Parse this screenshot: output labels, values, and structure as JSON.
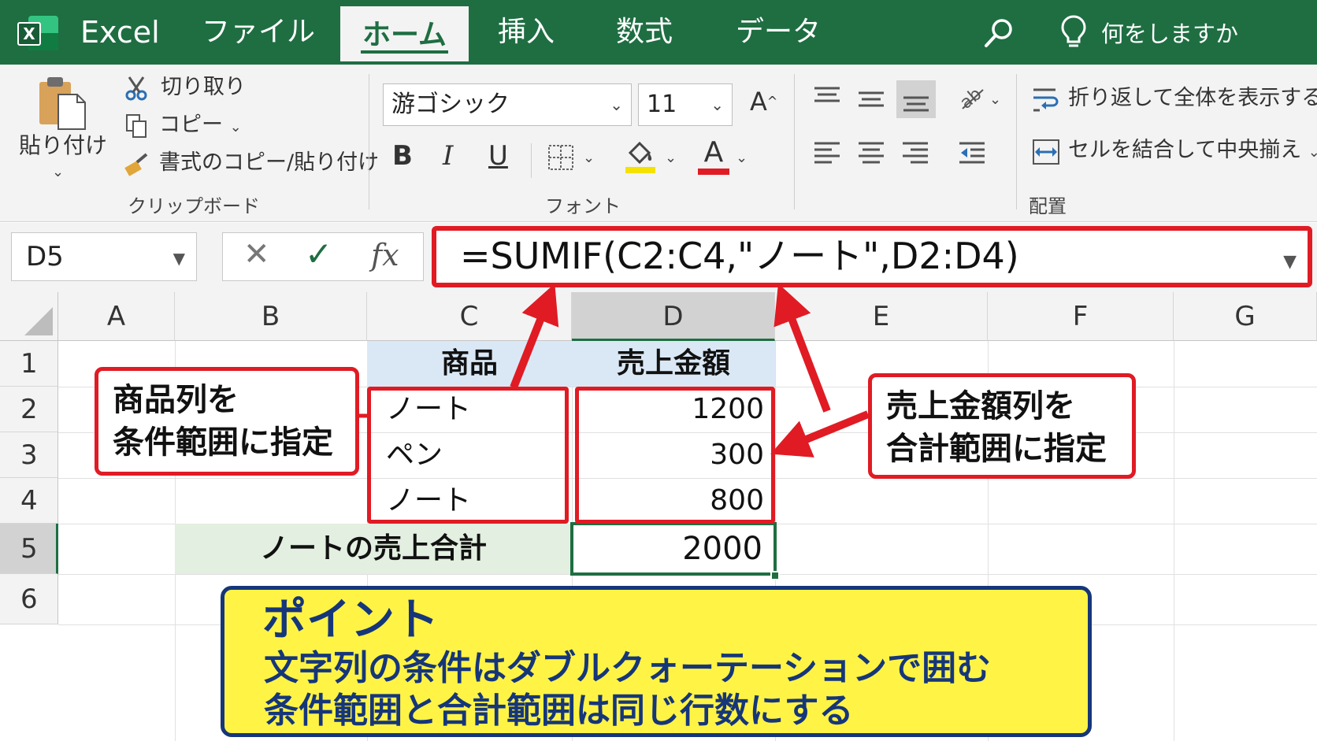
{
  "app": {
    "name": "Excel",
    "logo_letter": "X"
  },
  "tabs": [
    {
      "label": "ファイル"
    },
    {
      "label": "ホーム",
      "active": true
    },
    {
      "label": "挿入"
    },
    {
      "label": "数式"
    },
    {
      "label": "データ"
    }
  ],
  "search": {
    "tell_me": "何をしますか"
  },
  "ribbon": {
    "clipboard": {
      "paste": "貼り付け",
      "cut": "切り取り",
      "copy": "コピー",
      "format_painter": "書式のコピー/貼り付け",
      "label": "クリップボード"
    },
    "font": {
      "font_name": "游ゴシック",
      "font_size": "11",
      "bold": "B",
      "italic": "I",
      "underline": "U",
      "font_color_glyph": "A",
      "grow_glyph": "A",
      "label": "フォント"
    },
    "alignment": {
      "wrap_text": "折り返して全体を表示する",
      "merge_center": "セルを結合して中央揃え",
      "label": "配置"
    }
  },
  "formula_bar": {
    "name_box": "D5",
    "cancel_glyph": "✕",
    "enter_glyph": "✓",
    "fx_glyph": "fx",
    "formula": "=SUMIF(C2:C4,\"ノート\",D2:D4)"
  },
  "sheet": {
    "columns": [
      "A",
      "B",
      "C",
      "D",
      "E",
      "F",
      "G"
    ],
    "rows": [
      "1",
      "2",
      "3",
      "4",
      "5",
      "6"
    ],
    "header_row": {
      "c": "商品",
      "d": "売上金額"
    },
    "data": [
      {
        "item": "ノート",
        "amount": "1200"
      },
      {
        "item": "ペン",
        "amount": "300"
      },
      {
        "item": "ノート",
        "amount": "800"
      }
    ],
    "sum_label": "ノートの売上合計",
    "sum_value": "2000"
  },
  "annotations": {
    "left": {
      "line1": "商品列を",
      "line2": "条件範囲に指定"
    },
    "right": {
      "line1": "売上金額列を",
      "line2": "合計範囲に指定"
    },
    "point": {
      "title": "ポイント",
      "line1": "文字列の条件はダブルクォーテーションで囲む",
      "line2": "条件範囲と合計範囲は同じ行数にする"
    }
  },
  "colors": {
    "excel_green": "#1e6e42",
    "highlight_red": "#e01b24",
    "point_yellow": "#fff445",
    "point_navy": "#16367a"
  }
}
